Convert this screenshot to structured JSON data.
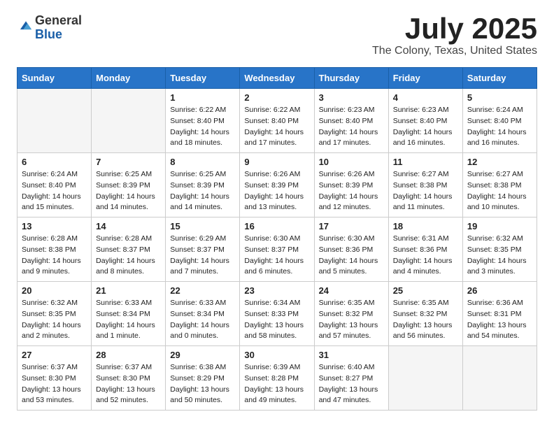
{
  "header": {
    "logo_general": "General",
    "logo_blue": "Blue",
    "month_title": "July 2025",
    "location": "The Colony, Texas, United States"
  },
  "weekdays": [
    "Sunday",
    "Monday",
    "Tuesday",
    "Wednesday",
    "Thursday",
    "Friday",
    "Saturday"
  ],
  "weeks": [
    [
      {
        "day": "",
        "sunrise": "",
        "sunset": "",
        "daylight": ""
      },
      {
        "day": "",
        "sunrise": "",
        "sunset": "",
        "daylight": ""
      },
      {
        "day": "1",
        "sunrise": "Sunrise: 6:22 AM",
        "sunset": "Sunset: 8:40 PM",
        "daylight": "Daylight: 14 hours and 18 minutes."
      },
      {
        "day": "2",
        "sunrise": "Sunrise: 6:22 AM",
        "sunset": "Sunset: 8:40 PM",
        "daylight": "Daylight: 14 hours and 17 minutes."
      },
      {
        "day": "3",
        "sunrise": "Sunrise: 6:23 AM",
        "sunset": "Sunset: 8:40 PM",
        "daylight": "Daylight: 14 hours and 17 minutes."
      },
      {
        "day": "4",
        "sunrise": "Sunrise: 6:23 AM",
        "sunset": "Sunset: 8:40 PM",
        "daylight": "Daylight: 14 hours and 16 minutes."
      },
      {
        "day": "5",
        "sunrise": "Sunrise: 6:24 AM",
        "sunset": "Sunset: 8:40 PM",
        "daylight": "Daylight: 14 hours and 16 minutes."
      }
    ],
    [
      {
        "day": "6",
        "sunrise": "Sunrise: 6:24 AM",
        "sunset": "Sunset: 8:40 PM",
        "daylight": "Daylight: 14 hours and 15 minutes."
      },
      {
        "day": "7",
        "sunrise": "Sunrise: 6:25 AM",
        "sunset": "Sunset: 8:39 PM",
        "daylight": "Daylight: 14 hours and 14 minutes."
      },
      {
        "day": "8",
        "sunrise": "Sunrise: 6:25 AM",
        "sunset": "Sunset: 8:39 PM",
        "daylight": "Daylight: 14 hours and 14 minutes."
      },
      {
        "day": "9",
        "sunrise": "Sunrise: 6:26 AM",
        "sunset": "Sunset: 8:39 PM",
        "daylight": "Daylight: 14 hours and 13 minutes."
      },
      {
        "day": "10",
        "sunrise": "Sunrise: 6:26 AM",
        "sunset": "Sunset: 8:39 PM",
        "daylight": "Daylight: 14 hours and 12 minutes."
      },
      {
        "day": "11",
        "sunrise": "Sunrise: 6:27 AM",
        "sunset": "Sunset: 8:38 PM",
        "daylight": "Daylight: 14 hours and 11 minutes."
      },
      {
        "day": "12",
        "sunrise": "Sunrise: 6:27 AM",
        "sunset": "Sunset: 8:38 PM",
        "daylight": "Daylight: 14 hours and 10 minutes."
      }
    ],
    [
      {
        "day": "13",
        "sunrise": "Sunrise: 6:28 AM",
        "sunset": "Sunset: 8:38 PM",
        "daylight": "Daylight: 14 hours and 9 minutes."
      },
      {
        "day": "14",
        "sunrise": "Sunrise: 6:28 AM",
        "sunset": "Sunset: 8:37 PM",
        "daylight": "Daylight: 14 hours and 8 minutes."
      },
      {
        "day": "15",
        "sunrise": "Sunrise: 6:29 AM",
        "sunset": "Sunset: 8:37 PM",
        "daylight": "Daylight: 14 hours and 7 minutes."
      },
      {
        "day": "16",
        "sunrise": "Sunrise: 6:30 AM",
        "sunset": "Sunset: 8:37 PM",
        "daylight": "Daylight: 14 hours and 6 minutes."
      },
      {
        "day": "17",
        "sunrise": "Sunrise: 6:30 AM",
        "sunset": "Sunset: 8:36 PM",
        "daylight": "Daylight: 14 hours and 5 minutes."
      },
      {
        "day": "18",
        "sunrise": "Sunrise: 6:31 AM",
        "sunset": "Sunset: 8:36 PM",
        "daylight": "Daylight: 14 hours and 4 minutes."
      },
      {
        "day": "19",
        "sunrise": "Sunrise: 6:32 AM",
        "sunset": "Sunset: 8:35 PM",
        "daylight": "Daylight: 14 hours and 3 minutes."
      }
    ],
    [
      {
        "day": "20",
        "sunrise": "Sunrise: 6:32 AM",
        "sunset": "Sunset: 8:35 PM",
        "daylight": "Daylight: 14 hours and 2 minutes."
      },
      {
        "day": "21",
        "sunrise": "Sunrise: 6:33 AM",
        "sunset": "Sunset: 8:34 PM",
        "daylight": "Daylight: 14 hours and 1 minute."
      },
      {
        "day": "22",
        "sunrise": "Sunrise: 6:33 AM",
        "sunset": "Sunset: 8:34 PM",
        "daylight": "Daylight: 14 hours and 0 minutes."
      },
      {
        "day": "23",
        "sunrise": "Sunrise: 6:34 AM",
        "sunset": "Sunset: 8:33 PM",
        "daylight": "Daylight: 13 hours and 58 minutes."
      },
      {
        "day": "24",
        "sunrise": "Sunrise: 6:35 AM",
        "sunset": "Sunset: 8:32 PM",
        "daylight": "Daylight: 13 hours and 57 minutes."
      },
      {
        "day": "25",
        "sunrise": "Sunrise: 6:35 AM",
        "sunset": "Sunset: 8:32 PM",
        "daylight": "Daylight: 13 hours and 56 minutes."
      },
      {
        "day": "26",
        "sunrise": "Sunrise: 6:36 AM",
        "sunset": "Sunset: 8:31 PM",
        "daylight": "Daylight: 13 hours and 54 minutes."
      }
    ],
    [
      {
        "day": "27",
        "sunrise": "Sunrise: 6:37 AM",
        "sunset": "Sunset: 8:30 PM",
        "daylight": "Daylight: 13 hours and 53 minutes."
      },
      {
        "day": "28",
        "sunrise": "Sunrise: 6:37 AM",
        "sunset": "Sunset: 8:30 PM",
        "daylight": "Daylight: 13 hours and 52 minutes."
      },
      {
        "day": "29",
        "sunrise": "Sunrise: 6:38 AM",
        "sunset": "Sunset: 8:29 PM",
        "daylight": "Daylight: 13 hours and 50 minutes."
      },
      {
        "day": "30",
        "sunrise": "Sunrise: 6:39 AM",
        "sunset": "Sunset: 8:28 PM",
        "daylight": "Daylight: 13 hours and 49 minutes."
      },
      {
        "day": "31",
        "sunrise": "Sunrise: 6:40 AM",
        "sunset": "Sunset: 8:27 PM",
        "daylight": "Daylight: 13 hours and 47 minutes."
      },
      {
        "day": "",
        "sunrise": "",
        "sunset": "",
        "daylight": ""
      },
      {
        "day": "",
        "sunrise": "",
        "sunset": "",
        "daylight": ""
      }
    ]
  ]
}
